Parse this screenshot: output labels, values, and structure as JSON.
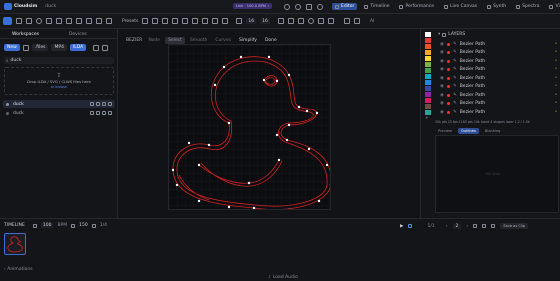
{
  "app": {
    "name": "Cloudsim",
    "file": "duck"
  },
  "topbar": {
    "badge": "Link · 100.0 BPM ⌁",
    "tabs": [
      {
        "label": "Editor",
        "active": true
      },
      {
        "label": "Timeline",
        "active": false
      },
      {
        "label": "Performance",
        "active": false
      },
      {
        "label": "Live Canvas",
        "active": false
      },
      {
        "label": "Synth",
        "active": false
      },
      {
        "label": "Spectra",
        "active": false
      },
      {
        "label": "Video",
        "active": false
      }
    ]
  },
  "toolbar": {
    "presets_label": "Presets",
    "stroke_value": "16",
    "size_value": "16",
    "zoom_label": "1/1",
    "ai_label": "AI"
  },
  "left": {
    "tabs": [
      {
        "label": "Workspaces",
        "active": true
      },
      {
        "label": "Devices",
        "active": false
      }
    ],
    "buttons": {
      "new": "New",
      "files": ".files",
      "mp4": "MP4",
      "ilda": "ILDA"
    },
    "search_value": "duck",
    "dropzone": {
      "text": "Drop ILDA / SVG / CLWS files here",
      "sub": "or browse"
    },
    "items": [
      {
        "name": "duck",
        "selected": true
      },
      {
        "name": "duck",
        "selected": false
      }
    ]
  },
  "canvas": {
    "bezier_label": "BEZIER",
    "modes": [
      {
        "label": "Node",
        "active": false
      },
      {
        "label": "Select",
        "active": true
      },
      {
        "label": "Smooth",
        "active": false
      },
      {
        "label": "Curves",
        "active": false
      },
      {
        "label": "Simplify",
        "active": false
      },
      {
        "label": "Done",
        "active": false
      }
    ]
  },
  "right": {
    "colors": [
      "#ffffff",
      "#e53935",
      "#f4511e",
      "#f9a825",
      "#fdd835",
      "#7cb342",
      "#43a047",
      "#00acc1",
      "#1e88e5",
      "#3949ab",
      "#8e24aa",
      "#d81b60",
      "#6d4c41",
      "#26a69a"
    ],
    "layers_title": "LAYERS",
    "layers": [
      "Bezier Path",
      "Bezier Path",
      "Bezier Path",
      "Bezier Path",
      "Bezier Path",
      "Bezier Path",
      "Bezier Path",
      "Bezier Path",
      "Bezier Path"
    ],
    "stats": "20k pts 25 fps 1180 pts 10k blank 4 shapes laser 1.2 / 1.5k",
    "tabs": [
      {
        "label": "Preview",
        "active": false
      },
      {
        "label": "Outlines",
        "active": true
      },
      {
        "label": "Blanking",
        "active": false
      }
    ],
    "empty_label": "No laser"
  },
  "timeline": {
    "title": "TIMELINE",
    "bpm": "100",
    "fps_label": "BPM",
    "len": "150",
    "rate_label": "1/4",
    "page": "2",
    "page_total": "1/1",
    "save_label": "Save as Clip",
    "clip_name": "duck",
    "footer": "Animations",
    "load_audio": "Load Audio"
  }
}
